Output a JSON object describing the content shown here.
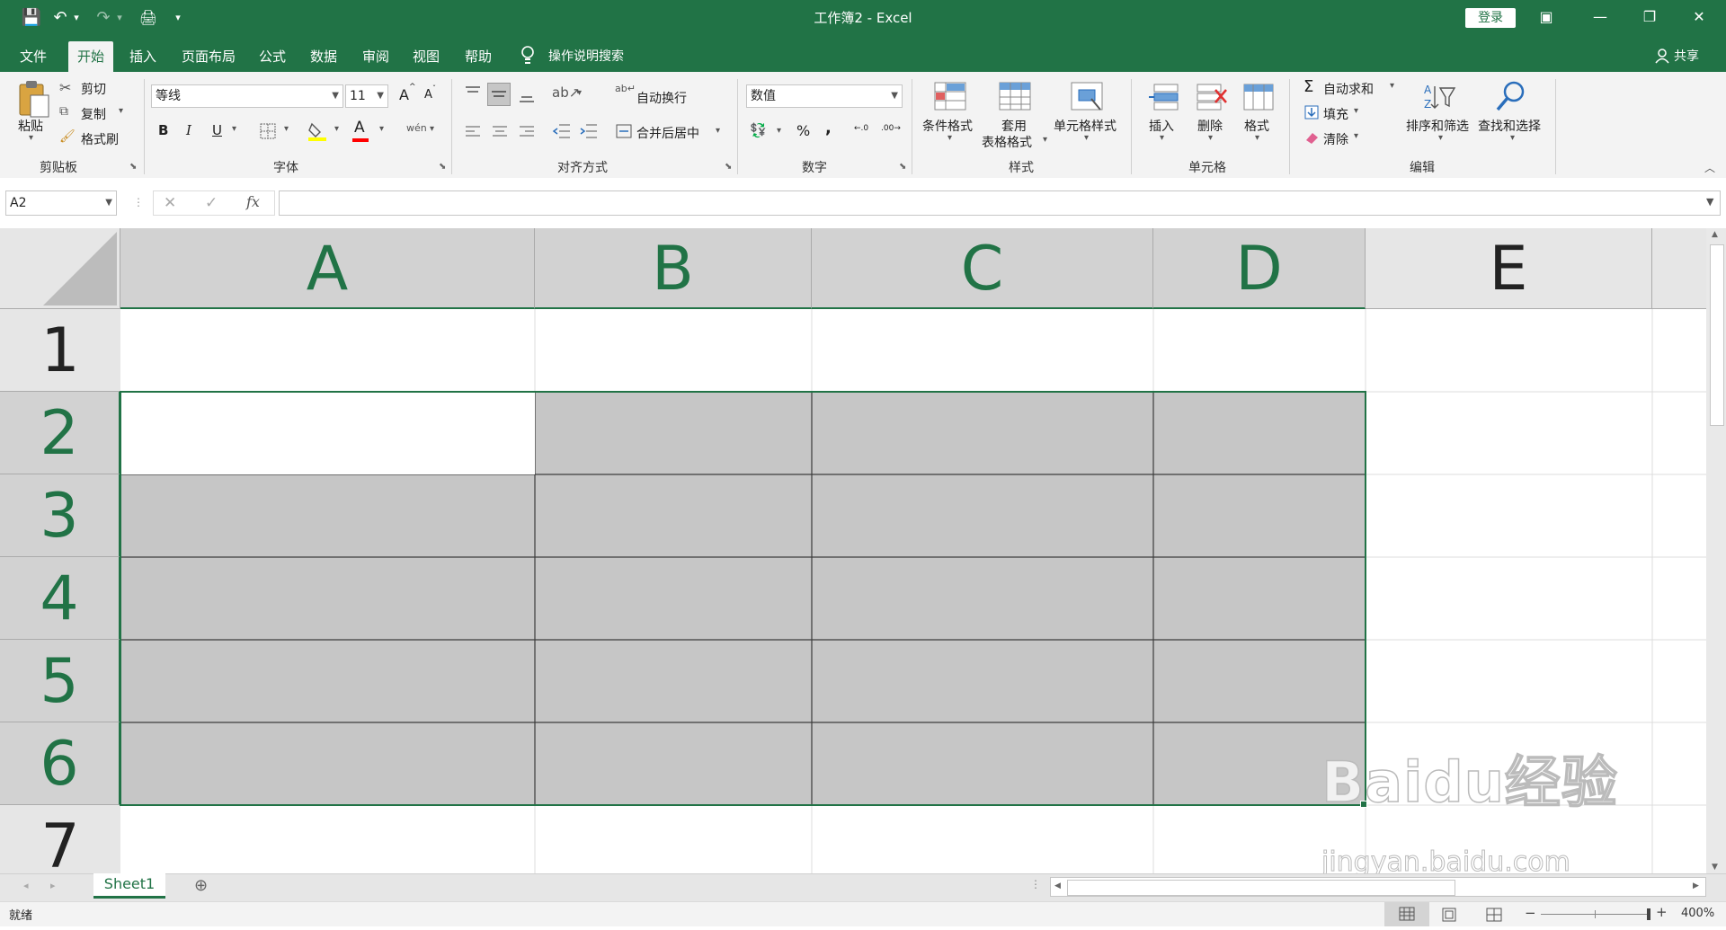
{
  "window": {
    "title": "工作簿2  -  Excel",
    "login_label": "登录",
    "controls": {
      "ribbon_display": "▣",
      "minimize": "—",
      "restore": "❐",
      "close": "✕"
    }
  },
  "quick_access": {
    "save": "💾",
    "undo": "↶",
    "undo_arrow": "▾",
    "redo": "↷",
    "redo_arrow": "▾",
    "print_preview": "🖨",
    "customize": "▾"
  },
  "tabs": [
    {
      "label": "文件"
    },
    {
      "label": "开始"
    },
    {
      "label": "插入"
    },
    {
      "label": "页面布局"
    },
    {
      "label": "公式"
    },
    {
      "label": "数据"
    },
    {
      "label": "审阅"
    },
    {
      "label": "视图"
    },
    {
      "label": "帮助"
    }
  ],
  "tell_me": "操作说明搜索",
  "share_label": "共享",
  "ribbon": {
    "clipboard": {
      "label": "剪贴板",
      "paste": "粘贴",
      "cut": "剪切",
      "copy": "复制",
      "format_painter": "格式刷"
    },
    "font": {
      "label": "字体",
      "font_name": "等线",
      "font_size": "11",
      "bold": "B",
      "italic": "I",
      "underline": "U",
      "grow": "A",
      "shrink": "A",
      "font_color_letter": "A",
      "phonetic": "wén"
    },
    "alignment": {
      "label": "对齐方式",
      "wrap": "自动换行",
      "merge": "合并后居中"
    },
    "number": {
      "label": "数字",
      "format": "数值",
      "percent": "%",
      "comma": ",",
      "inc_decimal": "←.0",
      "dec_decimal": ".00→"
    },
    "styles": {
      "label": "样式",
      "conditional": "条件格式",
      "table_line1": "套用",
      "table_line2": "表格格式",
      "cell_styles": "单元格样式"
    },
    "cells": {
      "label": "单元格",
      "insert": "插入",
      "delete": "删除",
      "format": "格式"
    },
    "editing": {
      "label": "编辑",
      "autosum": "自动求和",
      "fill": "填充",
      "clear": "清除",
      "sort_filter": "排序和筛选",
      "find_select": "查找和选择"
    }
  },
  "formula_bar": {
    "name_box": "A2",
    "cancel": "✕",
    "enter": "✓",
    "fx": "fx",
    "formula": ""
  },
  "grid": {
    "columns": [
      "A",
      "B",
      "C",
      "D",
      "E"
    ],
    "rows": [
      "1",
      "2",
      "3",
      "4",
      "5",
      "6",
      "7"
    ],
    "selected_range": "A2:D6",
    "active_cell": "A2",
    "colors": {
      "header_selected": "#d2d2d2",
      "header_text_selected": "#217346",
      "selection_fill": "#c6c6c6",
      "selection_border": "#217346"
    }
  },
  "sheet_tabs": {
    "active": "Sheet1",
    "add": "⊕"
  },
  "status": {
    "ready": "就绪",
    "zoom": "400%",
    "zoom_minus": "−",
    "zoom_plus": "+"
  },
  "watermark": {
    "brand": "Baidu经验",
    "url": "jingyan.baidu.com"
  },
  "theme": {
    "accent": "#217346"
  }
}
